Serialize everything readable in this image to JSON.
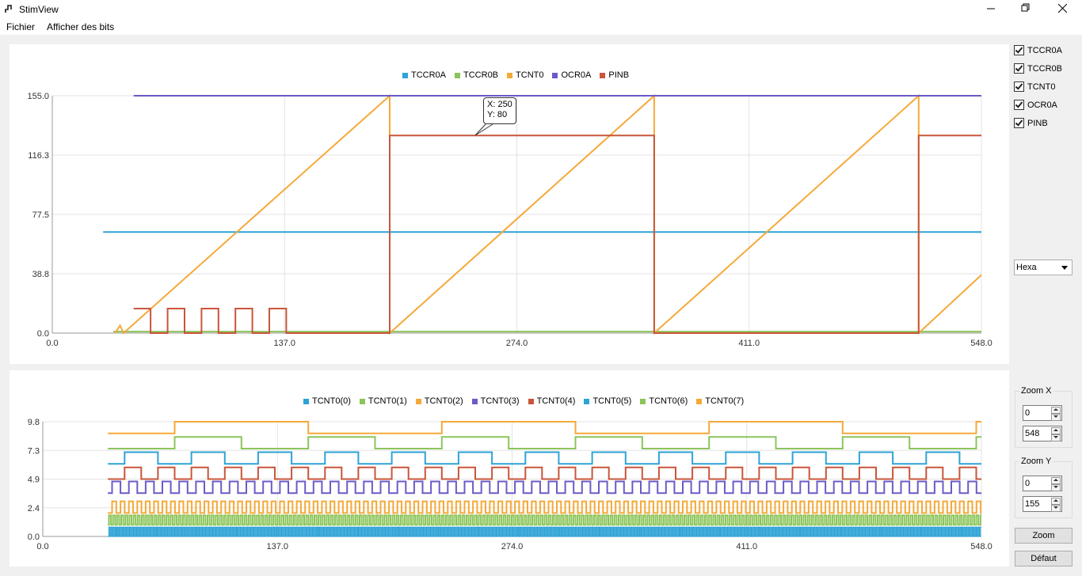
{
  "window": {
    "title": "StimView"
  },
  "menu": [
    "Fichier",
    "Afficher des bits"
  ],
  "colors": {
    "blue": "#2ea3d6",
    "green": "#8cc45a",
    "orange": "#f5a938",
    "purple": "#6b5bc7",
    "red": "#c9553a"
  },
  "top_chart": {
    "legend": [
      {
        "name": "TCCR0A",
        "color": "#2ea3d6"
      },
      {
        "name": "TCCR0B",
        "color": "#8cc45a"
      },
      {
        "name": "TCNT0",
        "color": "#f5a938"
      },
      {
        "name": "OCR0A",
        "color": "#6b5bc7"
      },
      {
        "name": "PINB",
        "color": "#c9553a"
      }
    ],
    "y_ticks": [
      "155.0",
      "116.3",
      "77.5",
      "38.8",
      "0.0"
    ],
    "x_ticks": [
      "0.0",
      "137.0",
      "274.0",
      "411.0",
      "548.0"
    ],
    "tooltip": {
      "x": "X: 250",
      "y": "Y: 80"
    }
  },
  "bottom_chart": {
    "legend": [
      {
        "name": "TCNT0(0)",
        "color": "#2ea3d6"
      },
      {
        "name": "TCNT0(1)",
        "color": "#8cc45a"
      },
      {
        "name": "TCNT0(2)",
        "color": "#f5a938"
      },
      {
        "name": "TCNT0(3)",
        "color": "#6b5bc7"
      },
      {
        "name": "TCNT0(4)",
        "color": "#c9553a"
      },
      {
        "name": "TCNT0(5)",
        "color": "#2ea3d6"
      },
      {
        "name": "TCNT0(6)",
        "color": "#8cc45a"
      },
      {
        "name": "TCNT0(7)",
        "color": "#f5a938"
      }
    ],
    "y_ticks": [
      "9.8",
      "7.3",
      "4.9",
      "2.4",
      "0.0"
    ],
    "x_ticks": [
      "0.0",
      "137.0",
      "274.0",
      "411.0",
      "548.0"
    ]
  },
  "chart_data": [
    {
      "type": "line",
      "xlim": [
        0,
        548
      ],
      "ylim": [
        0,
        155
      ],
      "series": [
        {
          "name": "TCCR0A",
          "points": [
            [
              30,
              66
            ],
            [
              548,
              66
            ]
          ]
        },
        {
          "name": "TCCR0B",
          "points": [
            [
              36,
              1
            ],
            [
              548,
              1
            ]
          ]
        },
        {
          "name": "TCNT0",
          "points": [
            [
              37,
              0
            ],
            [
              40,
              5
            ],
            [
              42,
              0
            ],
            [
              199,
              155
            ],
            [
              199,
              129
            ],
            [
              199,
              0
            ],
            [
              355,
              155
            ],
            [
              355,
              129
            ],
            [
              355,
              0
            ],
            [
              511,
              155
            ],
            [
              511,
              129
            ],
            [
              511,
              0
            ],
            [
              548,
              38
            ]
          ]
        },
        {
          "name": "OCR0A",
          "points": [
            [
              48,
              155
            ],
            [
              548,
              155
            ]
          ]
        },
        {
          "name": "PINB",
          "points": [
            [
              48,
              16
            ],
            [
              58,
              16
            ],
            [
              58,
              0
            ],
            [
              68,
              0
            ],
            [
              68,
              16
            ],
            [
              78,
              16
            ],
            [
              78,
              0
            ],
            [
              88,
              0
            ],
            [
              88,
              16
            ],
            [
              98,
              16
            ],
            [
              98,
              0
            ],
            [
              108,
              0
            ],
            [
              108,
              16
            ],
            [
              118,
              16
            ],
            [
              118,
              0
            ],
            [
              128,
              0
            ],
            [
              128,
              16
            ],
            [
              138,
              16
            ],
            [
              138,
              0
            ],
            [
              199,
              0
            ],
            [
              199,
              129
            ],
            [
              355,
              129
            ],
            [
              355,
              0
            ],
            [
              511,
              0
            ],
            [
              511,
              129
            ],
            [
              548,
              129
            ]
          ]
        }
      ]
    },
    {
      "type": "line",
      "xlim": [
        0,
        548
      ],
      "ylim": [
        0,
        9.8
      ],
      "series": [
        {
          "name": "TCNT0(0)",
          "low": 0.0,
          "high": 0.8,
          "period": 1.2
        },
        {
          "name": "TCNT0(1)",
          "low": 1.0,
          "high": 1.8,
          "period": 2.4
        },
        {
          "name": "TCNT0(2)",
          "low": 2.0,
          "high": 3.0,
          "period": 4.9
        },
        {
          "name": "TCNT0(3)",
          "low": 3.7,
          "high": 4.7,
          "period": 9.8
        },
        {
          "name": "TCNT0(4)",
          "low": 4.9,
          "high": 5.9,
          "period": 19.5
        },
        {
          "name": "TCNT0(5)",
          "low": 6.2,
          "high": 7.2,
          "period": 39
        },
        {
          "name": "TCNT0(6)",
          "low": 7.5,
          "high": 8.5,
          "period": 78
        },
        {
          "name": "TCNT0(7)",
          "low": 8.8,
          "high": 9.8,
          "period": 156
        }
      ]
    }
  ],
  "side": {
    "checkboxes": [
      "TCCR0A",
      "TCCR0B",
      "TCNT0",
      "OCR0A",
      "PINB"
    ],
    "format_select": "Hexa",
    "zoom_x": {
      "title": "Zoom X",
      "min": "0",
      "max": "548"
    },
    "zoom_y": {
      "title": "Zoom Y",
      "min": "0",
      "max": "155"
    },
    "zoom_button": "Zoom",
    "default_button": "Défaut"
  }
}
